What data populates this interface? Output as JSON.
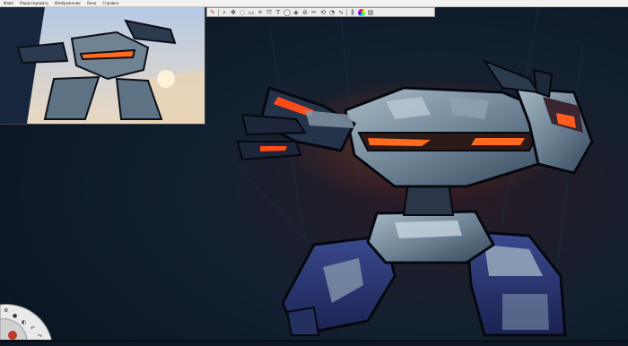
{
  "menu": {
    "items": [
      "Файл",
      "Редактировать",
      "Изображение",
      "Окно",
      "Справка"
    ]
  },
  "toolbar": {
    "tools": [
      {
        "icon": "brush-icon",
        "glyph": "✎"
      },
      {
        "icon": "zoom-icon",
        "glyph": "⌕"
      },
      {
        "icon": "pan-icon",
        "glyph": "✥"
      },
      {
        "icon": "lasso-icon",
        "glyph": "◌"
      },
      {
        "icon": "select-rect-icon",
        "glyph": "▭"
      },
      {
        "icon": "crop-icon",
        "glyph": "⌗"
      },
      {
        "icon": "move-icon",
        "glyph": "⤧"
      },
      {
        "icon": "text-icon",
        "glyph": "T"
      },
      {
        "icon": "ellipse-icon",
        "glyph": "◯"
      },
      {
        "icon": "fill-icon",
        "glyph": "◈"
      },
      {
        "icon": "eyedropper-icon",
        "glyph": "⊘"
      },
      {
        "icon": "guide-icon",
        "glyph": "✂"
      },
      {
        "icon": "symmetry-icon",
        "glyph": "⟲"
      },
      {
        "icon": "ruler-icon",
        "glyph": "◔"
      },
      {
        "icon": "curve-icon",
        "glyph": "∿"
      },
      {
        "icon": "brushes-palette-icon",
        "glyph": "⫼"
      },
      {
        "icon": "color-wheel-icon",
        "glyph": "●"
      },
      {
        "icon": "layers-icon",
        "glyph": "▤"
      }
    ]
  },
  "colors": {
    "background": "#0c1826",
    "accent_glow": "#ff5a1f",
    "robot_metal": "#7f95a6",
    "robot_dark": "#253447",
    "robot_blue": "#2a3a78"
  },
  "radial_menu": {
    "icons": [
      "settings-icon",
      "brush-size-icon",
      "opacity-icon",
      "undo-icon",
      "redo-icon",
      "color-puck-icon"
    ]
  }
}
